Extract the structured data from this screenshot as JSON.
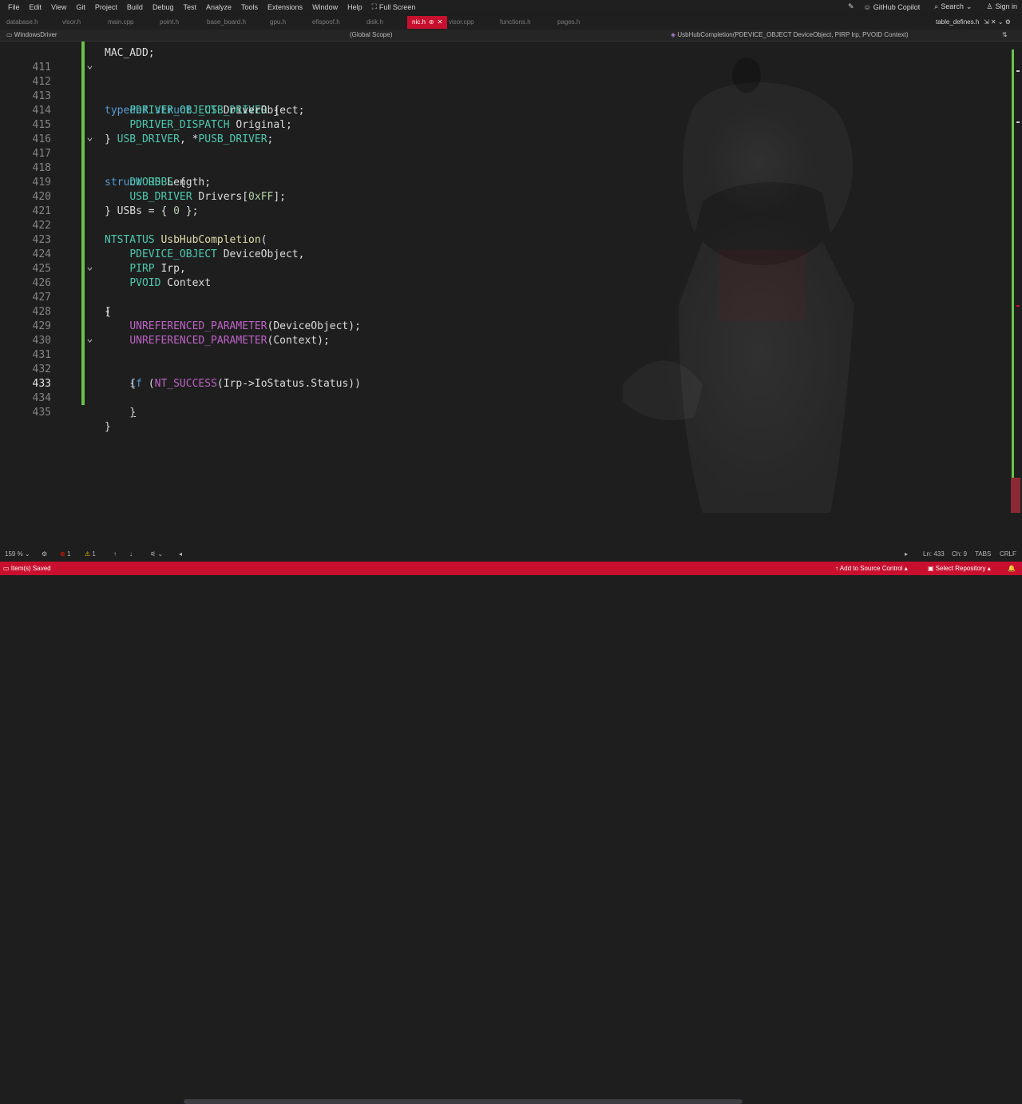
{
  "menu": [
    "File",
    "Edit",
    "View",
    "Git",
    "Project",
    "Build",
    "Debug",
    "Test",
    "Analyze",
    "Tools",
    "Extensions",
    "Window",
    "Help"
  ],
  "menu_right": {
    "fullscreen": "Full Screen",
    "copilot": "GitHub Copilot",
    "search": "Search",
    "signin": "Sign in"
  },
  "tabs": [
    "database.h",
    "visor.h",
    "main.cpp",
    "point.h",
    "base_board.h",
    "gpu.h",
    "efispoof.h",
    "disk.h",
    "nic.h",
    "visor.cpp",
    "functions.h",
    "pages.h"
  ],
  "active_tab": "nic.h",
  "tab_right": "table_defines.h",
  "nav": {
    "project": "WindowsDriver",
    "scope": "(Global Scope)",
    "member": "UsbHubCompletion(PDEVICE_OBJECT DeviceObject, PIRP Irp, PVOID Context)"
  },
  "code": {
    "partial_top": "MAC_ADD;",
    "l411": "411",
    "l412": "412",
    "l413": "413",
    "l414": "414",
    "l415": "415",
    "l416": "416",
    "l417": "417",
    "l418": "418",
    "l419": "419",
    "l420": "420",
    "l421": "421",
    "l422": "422",
    "l423": "423",
    "l424": "424",
    "l425": "425",
    "l426": "426",
    "l427": "427",
    "l428": "428",
    "l429": "429",
    "l430": "430",
    "l431": "431",
    "l432": "432",
    "l433": "433",
    "l434": "434",
    "l435": "435"
  },
  "editor_status": {
    "zoom": "159 %",
    "errors": "1",
    "warnings": "1",
    "position": "Ln: 433",
    "col": "Ch: 9",
    "tabs": "TABS",
    "eol": "CRLF"
  },
  "status": {
    "left": "Item(s) Saved",
    "source_control": "Add to Source Control",
    "repo": "Select Repository"
  },
  "colors": {
    "accent": "#c8102e",
    "gutter_change": "#6cc24a",
    "keyword": "#569cd6",
    "type": "#4ec9b0",
    "macro": "#bd63c5",
    "function": "#dcdcaa"
  }
}
